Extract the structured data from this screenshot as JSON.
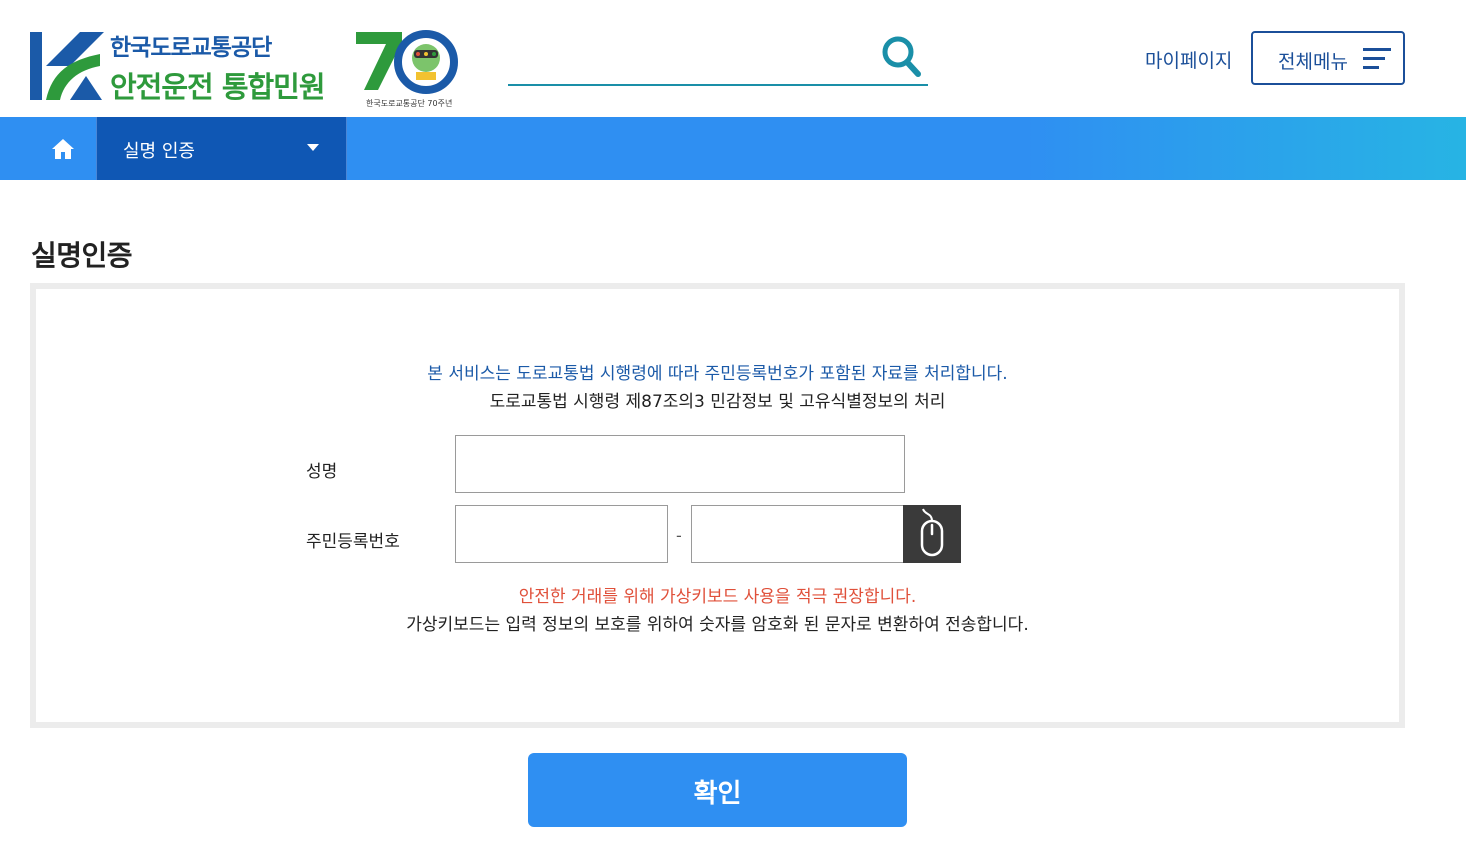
{
  "header": {
    "logo": {
      "line1": "한국도로교통공단",
      "line2": "안전운전 통합민원"
    },
    "anniversary": {
      "number": "70",
      "caption": "한국도로교통공단 70주년"
    },
    "search": {
      "placeholder": "",
      "value": ""
    },
    "mypage_label": "마이페이지",
    "allmenu_label": "전체메뉴"
  },
  "navbar": {
    "crumb_label": "실명 인증"
  },
  "main": {
    "title": "실명인증",
    "notice_blue": "본 서비스는 도로교통법 시행령에 따라 주민등록번호가 포함된 자료를 처리합니다.",
    "notice_black": "도로교통법 시행령 제87조의3 민감정보 및 고유식별정보의 처리",
    "form": {
      "name_label": "성명",
      "name_value": "",
      "rrn_label": "주민등록번호",
      "rrn_front_value": "",
      "rrn_dash": "-",
      "rrn_back_value": ""
    },
    "warn_red": "안전한 거래를 위해 가상키보드 사용을 적극 권장합니다.",
    "warn_black": "가상키보드는 입력 정보의 보호를 위하여 숫자를 암호화 된 문자로 변환하여 전송합니다.",
    "confirm_label": "확인"
  },
  "colors": {
    "primary_blue": "#2f8ff2",
    "dark_blue": "#0f57b4",
    "brand_blue": "#1b5aa8",
    "brand_green": "#2e9a3c",
    "warn_red": "#e0503a"
  }
}
